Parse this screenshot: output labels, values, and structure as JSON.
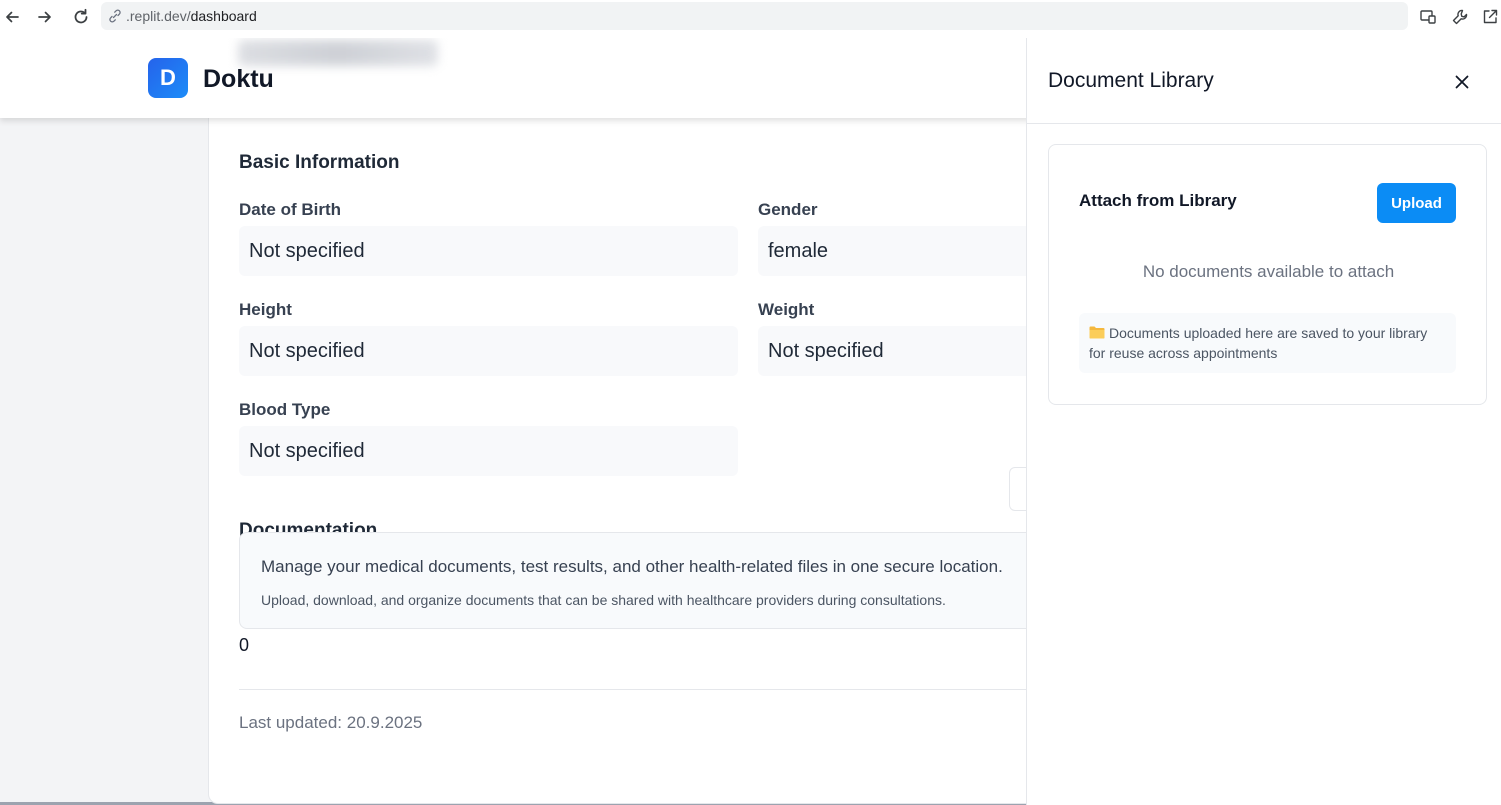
{
  "browser": {
    "url_host": ".replit.dev/",
    "url_path": "dashboard"
  },
  "header": {
    "logo_letter": "D",
    "brand_name": "Doktu"
  },
  "basic_info": {
    "title": "Basic Information",
    "fields": [
      {
        "label": "Date of Birth",
        "value": "Not specified"
      },
      {
        "label": "Gender",
        "value": "female"
      },
      {
        "label": "Height",
        "value": "Not specified"
      },
      {
        "label": "Weight",
        "value": "Not specified"
      },
      {
        "label": "Blood Type",
        "value": "Not specified"
      }
    ]
  },
  "documentation": {
    "title": "Documentation",
    "description": "Manage your medical documents, test results, and other health-related files in one secure location.",
    "subtext": "Upload, download, and organize documents that can be shared with healthcare providers during consultations.",
    "count": "0"
  },
  "footer": {
    "last_updated": "Last updated: 20.9.2025"
  },
  "drawer": {
    "title": "Document Library",
    "section_title": "Attach from Library",
    "upload_label": "Upload",
    "empty_message": "No documents available to attach",
    "note": "Documents uploaded here are saved to your library for reuse across appointments"
  },
  "colors": {
    "accent": "#0b8cf5",
    "logo": "#2563eb"
  },
  "icons": [
    "back-arrow-icon",
    "forward-arrow-icon",
    "reload-icon",
    "link-icon",
    "cast-icon",
    "wrench-icon",
    "open-external-icon",
    "close-icon",
    "folder-icon"
  ]
}
